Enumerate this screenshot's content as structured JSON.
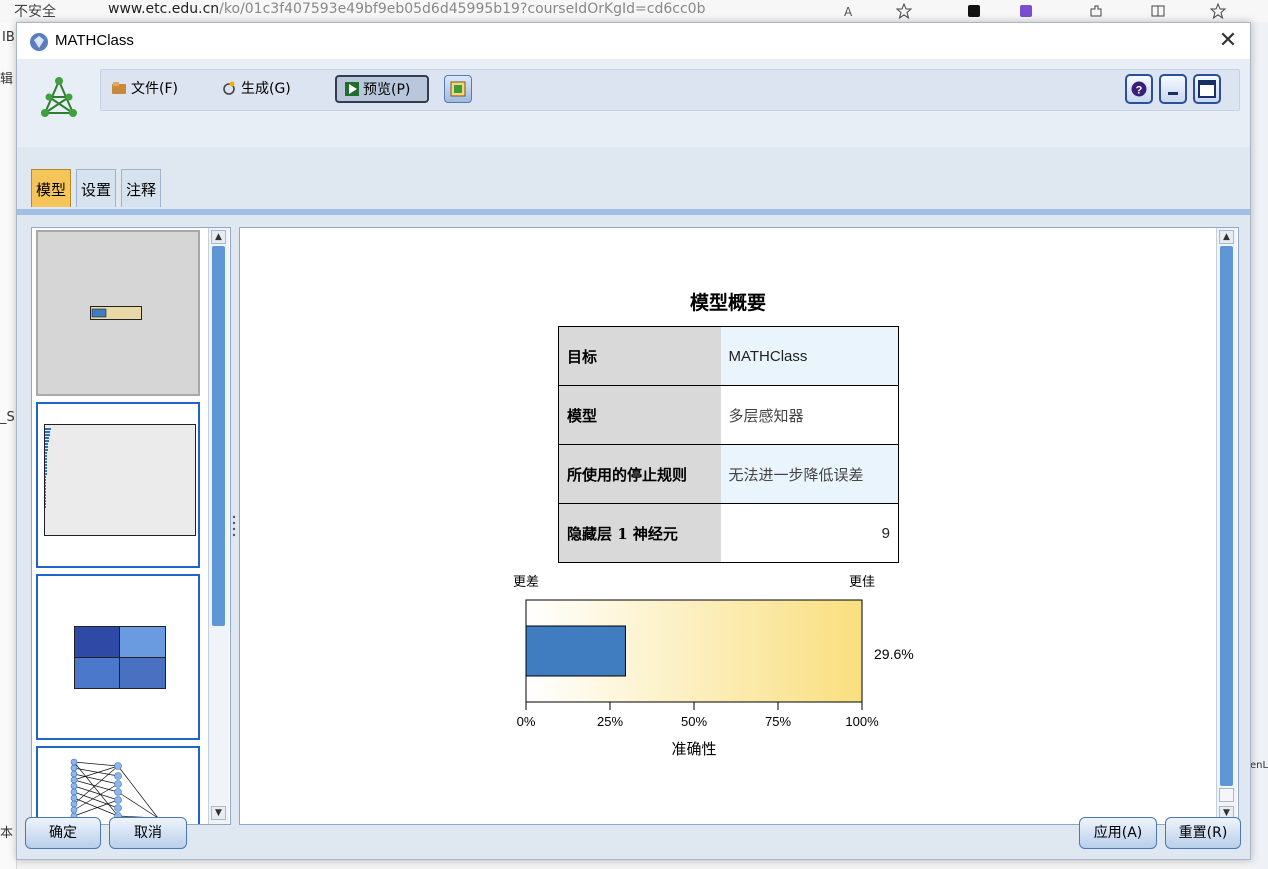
{
  "browser": {
    "security": "不安全",
    "url_host": "www.etc.edu.cn",
    "url_path": "/ko/01c3f407593e49bf9eb05d6d45995b19?courseIdOrKgId=cd6cc0b"
  },
  "background": {
    "left_fragment_1": "辑",
    "left_fragment_2": "_S",
    "left_fragment_3": "IB",
    "bottom_fragment": "本",
    "right_fragment": "enL"
  },
  "dialog": {
    "title": "MATHClass"
  },
  "toolbar": {
    "file": "文件(F)",
    "generate": "生成(G)",
    "preview": "预览(P)"
  },
  "tabs": [
    {
      "label": "模型",
      "active": true
    },
    {
      "label": "设置",
      "active": false
    },
    {
      "label": "注释",
      "active": false
    }
  ],
  "summary": {
    "title": "模型概要",
    "rows": [
      {
        "key": "目标",
        "value": "MATHClass"
      },
      {
        "key": "模型",
        "value": "多层感知器"
      },
      {
        "key": "所使用的停止规则",
        "value": "无法进一步降低误差"
      },
      {
        "key": "隐藏层 1 神经元",
        "value": "9"
      }
    ]
  },
  "chart_data": {
    "type": "bar",
    "categories": [
      ""
    ],
    "values": [
      29.6
    ],
    "value_label": "29.6%",
    "xlabel": "准确性",
    "xlim": [
      0,
      100
    ],
    "ticks": [
      "0%",
      "25%",
      "50%",
      "75%",
      "100%"
    ],
    "left_annotation": "更差",
    "right_annotation": "更佳",
    "bar_color": "#3f7cc0",
    "gradient_colors": [
      "#ffffff",
      "#f9df7e"
    ]
  },
  "buttons": {
    "ok": "确定",
    "cancel": "取消",
    "apply": "应用(A)",
    "reset": "重置(R)"
  },
  "colors": {
    "accent": "#1f64c6",
    "active_tab": "#f6c55a"
  }
}
